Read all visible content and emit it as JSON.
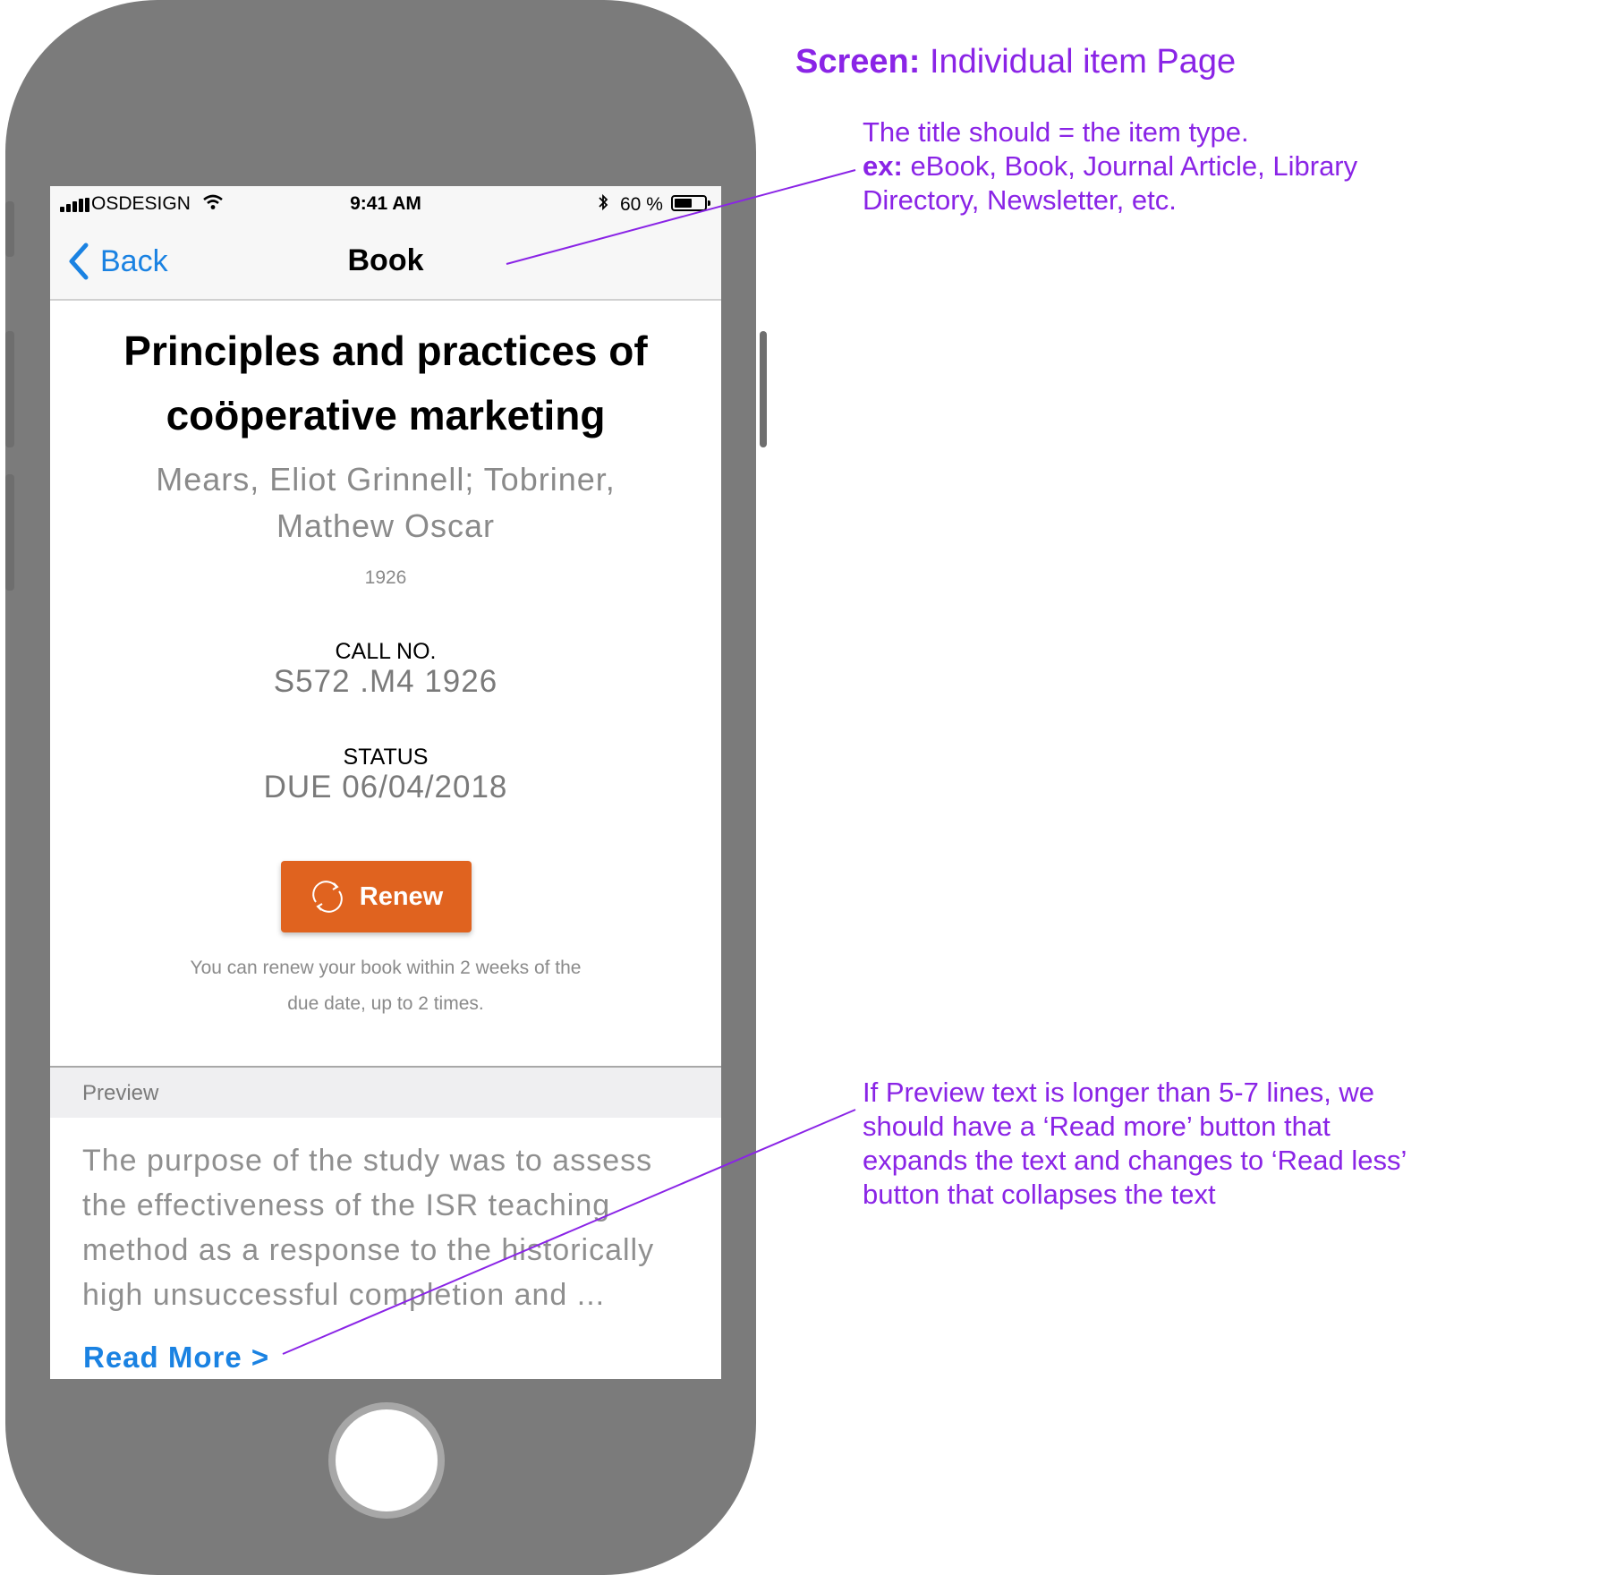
{
  "status_bar": {
    "carrier": "OSDESIGN",
    "time": "9:41 AM",
    "battery_percent": "60 %",
    "battery_level": 0.6,
    "icons": [
      "signal-icon",
      "wifi-icon",
      "bluetooth-icon",
      "battery-icon"
    ]
  },
  "nav": {
    "back_label": "Back",
    "title": "Book"
  },
  "item": {
    "title": "Principles and practices of coöperative marketing",
    "authors": "Mears, Eliot Grinnell; Tobriner, Mathew Oscar",
    "year": "1926",
    "call_no_label": "CALL NO.",
    "call_no": "S572 .M4 1926",
    "status_label": "STATUS",
    "status": "DUE 06/04/2018",
    "renew_label": "Renew",
    "renew_help": "You can renew your book within 2 weeks of the due date, up to 2 times."
  },
  "preview": {
    "header": "Preview",
    "text": "The purpose of the study was to assess the effectiveness of the ISR teaching method as a response to the historically high unsuccessful completion and ...",
    "read_more": "Read More >"
  },
  "annotations": {
    "screen_label": "Screen:",
    "screen_name": "Individual item Page",
    "note1_line1": "The title should = the item type.",
    "note1_ex_label": "ex:",
    "note1_ex_text": "eBook, Book, Journal Article, Library Directory, Newsletter, etc.",
    "note2": "If Preview text is longer than 5-7 lines, we should have a ‘Read more’ button that expands the text and changes to ‘Read less’ button that collapses the text"
  },
  "colors": {
    "accent_blue": "#1a82e2",
    "renew_orange": "#e0631f",
    "annotation_purple": "#8a24e6",
    "phone_gray": "#7b7b7b"
  }
}
